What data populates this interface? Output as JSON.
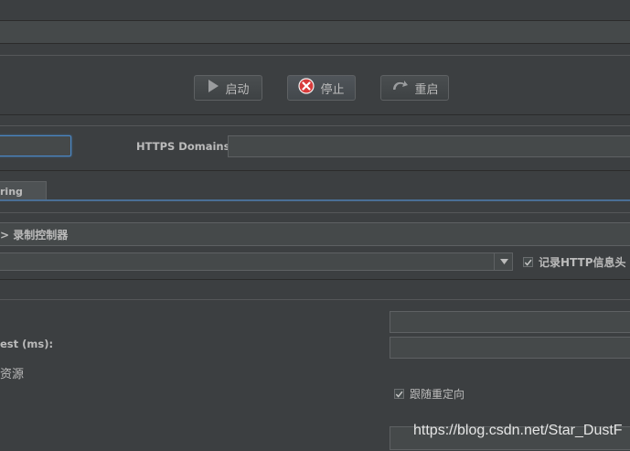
{
  "toolbar": {
    "start_label": "启动",
    "stop_label": "停止",
    "restart_label": "重启"
  },
  "https": {
    "label": "HTTPS Domains:",
    "value": ""
  },
  "tabs": {
    "partial_tab_label": "ring"
  },
  "target": {
    "label": "> 录制控制器"
  },
  "grouping": {
    "selected": "",
    "record_headers_label": "记录HTTP信息头",
    "record_headers_checked": true
  },
  "sampler": {
    "timeout_label": "est (ms):",
    "resources_label": "资源",
    "follow_redirects_label": "跟随重定向",
    "follow_redirects_checked": true
  },
  "watermark": "https://blog.csdn.net/Star_DustF",
  "colors": {
    "background": "#3c3f41",
    "focus_border": "#4a88c7",
    "stop_icon": "#d83b3b"
  }
}
